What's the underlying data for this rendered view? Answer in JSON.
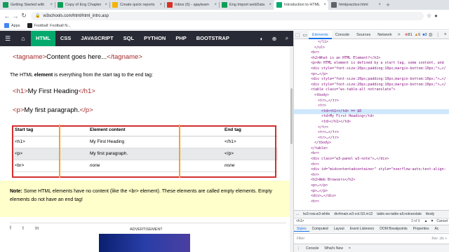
{
  "browser": {
    "tabs": [
      {
        "title": "Getting Started with",
        "color": "#0f9d58"
      },
      {
        "title": "Copy of Eng Chapter",
        "color": "#0f9d58"
      },
      {
        "title": "Create quick reports",
        "color": "#f4b400"
      },
      {
        "title": "Inbox (6) - ajayteam",
        "color": "#d93025"
      },
      {
        "title": "Eng Import webData",
        "color": "#0f9d58"
      },
      {
        "title": "Introduction to HTML",
        "color": "#04aa6d",
        "active": true
      },
      {
        "title": "htmlpractice.html",
        "color": "#5f6368"
      }
    ],
    "url": "w3schools.com/html/html_intro.asp",
    "bookmarks": [
      {
        "label": "Apps",
        "color": "#4285f4"
      },
      {
        "label": "Football: Football N...",
        "color": "#202124"
      }
    ]
  },
  "topnav": {
    "items": [
      "HTML",
      "CSS",
      "JAVASCRIPT",
      "SQL",
      "PYTHON",
      "PHP",
      "BOOTSTRAP"
    ],
    "active_index": 0
  },
  "content": {
    "code1": {
      "open": "<tagname>",
      "text": "Content goes here...",
      "close": "</tagname>"
    },
    "para_before": "The HTML ",
    "para_bold": "element",
    "para_after": " is everything from the start tag to the end tag:",
    "code2": {
      "open": "<h1>",
      "text": "My First Heading",
      "close": "</h1>"
    },
    "code3": {
      "open": "<p>",
      "text": "My first paragraph.",
      "close": "</p>"
    },
    "table": {
      "headers": [
        "Start tag",
        "Element content",
        "End tag"
      ],
      "rows": [
        [
          "<h1>",
          "My First Heading",
          "</h1>"
        ],
        [
          "<p>",
          "My first paragraph.",
          "</p>"
        ],
        [
          "<br>",
          "none",
          "none"
        ]
      ]
    },
    "note_label": "Note:",
    "note_text": " Some HTML elements have no content (like the <br> element). These elements are called empty elements. Empty elements do not have an end tag!",
    "ad_label": "ADVERTISEMENT"
  },
  "devtools": {
    "tabs": [
      "Elements",
      "Console",
      "Sources",
      "Network"
    ],
    "active_tab": "Elements",
    "badges": {
      "errors": "81",
      "warnings": "6",
      "info": "3"
    },
    "dom_lines": [
      {
        "indent": 6,
        "html": "</li>"
      },
      {
        "indent": 5,
        "html": "</ul>"
      },
      {
        "indent": 4,
        "html": "<br>"
      },
      {
        "indent": 4,
        "html": "<h2>What is an HTML Element?</h2>"
      },
      {
        "indent": 4,
        "html": "<p>An HTML element is defined by a start tag, some content, and"
      },
      {
        "indent": 4,
        "html": "<div style=\"font-size:20px;padding:10px;margin-bottom:10px;\">…</"
      },
      {
        "indent": 4,
        "html": "<p>…</p>"
      },
      {
        "indent": 4,
        "html": "<div style=\"font-size:20px;padding:10px;margin-bottom:10px;\">…</"
      },
      {
        "indent": 4,
        "html": "<div style=\"font-size:20px;padding:10px;margin-bottom:10px;\">…</"
      },
      {
        "indent": 4,
        "html": "<table class=\"ws-table-all notranslate\">"
      },
      {
        "indent": 5,
        "html": "<tbody>"
      },
      {
        "indent": 6,
        "html": "<tr>…</tr>"
      },
      {
        "indent": 6,
        "html": "<tr>"
      },
      {
        "indent": 7,
        "html": "<td><h1></td> == $0",
        "selected": true
      },
      {
        "indent": 7,
        "html": "<td>My First Heading</td>"
      },
      {
        "indent": 7,
        "html": "<td></h1></td>"
      },
      {
        "indent": 6,
        "html": "</tr>"
      },
      {
        "indent": 6,
        "html": "<tr>…</tr>"
      },
      {
        "indent": 6,
        "html": "<tr>…</tr>"
      },
      {
        "indent": 5,
        "html": "</tbody>"
      },
      {
        "indent": 4,
        "html": "</table>"
      },
      {
        "indent": 4,
        "html": "<br>"
      },
      {
        "indent": 4,
        "html": "<div class=\"w3-panel w3-note\">…</div>"
      },
      {
        "indent": 4,
        "html": "<hr>"
      },
      {
        "indent": 4,
        "html": "<div id=\"midcontentadcontainer\" style=\"overflow:auto;text-align:"
      },
      {
        "indent": 4,
        "html": "<hr>"
      },
      {
        "indent": 4,
        "html": "<h2>Web Browsers</h2>"
      },
      {
        "indent": 4,
        "html": "<p>…</p>"
      },
      {
        "indent": 4,
        "html": "<p>…</p>"
      },
      {
        "indent": 4,
        "html": "<div>…</div>"
      },
      {
        "indent": 4,
        "html": "<hr>"
      }
    ],
    "breadcrumbs": [
      "...",
      "lw3-row.w3-white",
      "div#main.w3-col.l10.m12",
      "table.ws-table-all.notranslate",
      "tbody"
    ],
    "search_query": "<h1>",
    "search_count": "3 of 9",
    "cancel_label": "Cancel",
    "style_tabs": [
      "Styles",
      "Computed",
      "Layout",
      "Event Listeners",
      "DOM Breakpoints",
      "Properties",
      "Ac"
    ],
    "filter_placeholder": "Filter",
    "filter_right": ":hov .cls +",
    "drawer_tabs": [
      "Console",
      "What's New"
    ]
  }
}
